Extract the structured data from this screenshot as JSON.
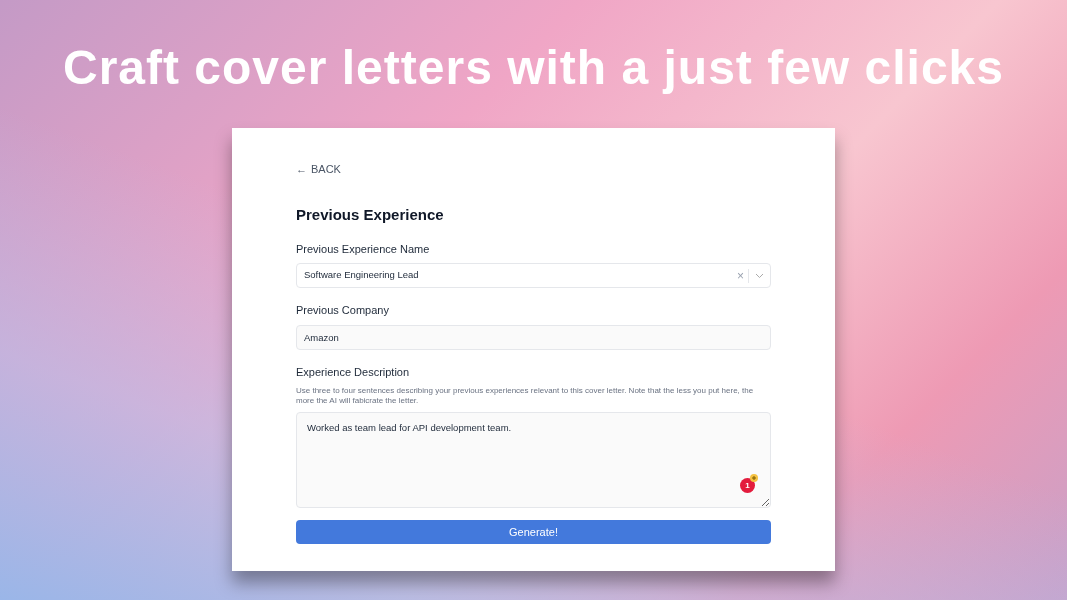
{
  "headline": "Craft cover letters with a just few clicks",
  "back": {
    "arrow": "←",
    "label": "BACK"
  },
  "title": "Previous Experience",
  "fields": [
    {
      "kind": "select",
      "label": "Previous Experience Name",
      "value": "Software Engineering Lead",
      "clear": "×"
    },
    {
      "kind": "input",
      "label": "Previous Company",
      "value": "Amazon"
    },
    {
      "kind": "textarea",
      "label": "Experience Description",
      "help": "Use three to four sentences describing your previous experiences relevant to this cover letter. Note that the less you put here, the more the AI will fabicrate the letter.",
      "value": "Worked as team lead for API development team.",
      "badge": "1"
    }
  ],
  "button": "Generate!"
}
